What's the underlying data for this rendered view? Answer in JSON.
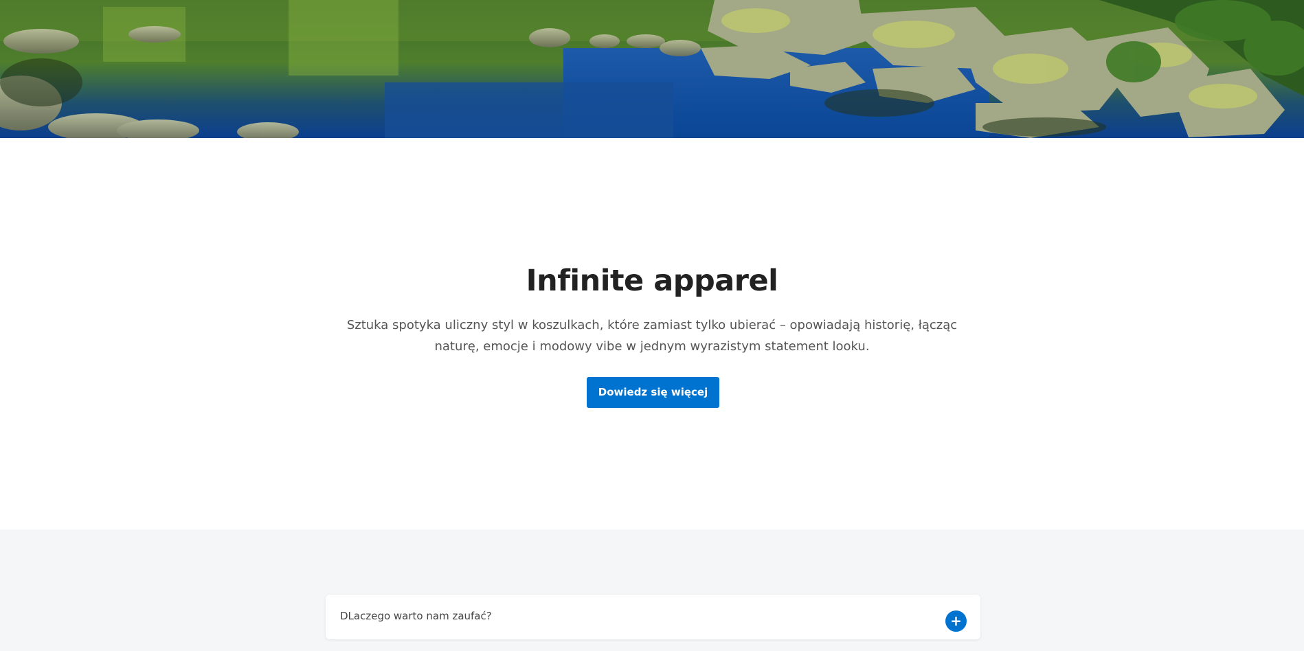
{
  "hero": {
    "image_alt": "Mountain lake with rocks"
  },
  "intro": {
    "title": "Infinite apparel",
    "text": "Sztuka spotyka uliczny styl w koszulkach, które zamiast tylko ubierać – opowiadają historię, łącząc naturę, emocje i modowy vibe w jednym wyrazistym statement looku.",
    "button_label": "Dowiedz się więcej"
  },
  "faq": {
    "items": [
      {
        "question": "DLaczego warto nam zaufać?",
        "toggle_symbol": "+"
      }
    ]
  },
  "colors": {
    "accent": "#0073d1",
    "heading": "#222222",
    "body_text": "#555555",
    "faq_background": "#f5f6f8"
  },
  "icons": {
    "faq_toggle": "plus-icon"
  }
}
